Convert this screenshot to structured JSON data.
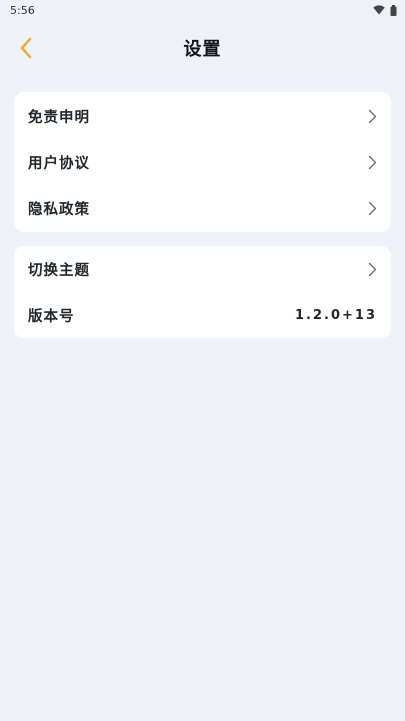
{
  "status_bar": {
    "time": "5:56",
    "icons": [
      "wifi-icon",
      "battery-icon"
    ]
  },
  "header": {
    "title": "设置",
    "back_icon": "chevron-left-icon",
    "accent_color": "#f5a623"
  },
  "groups": [
    {
      "items": [
        {
          "label": "免责申明",
          "icon": "chevron-right-icon"
        },
        {
          "label": "用户协议",
          "icon": "chevron-right-icon"
        },
        {
          "label": "隐私政策",
          "icon": "chevron-right-icon"
        }
      ]
    },
    {
      "items": [
        {
          "label": "切换主题",
          "icon": "chevron-right-icon"
        },
        {
          "label": "版本号",
          "value": "1.2.0+13"
        }
      ]
    }
  ]
}
